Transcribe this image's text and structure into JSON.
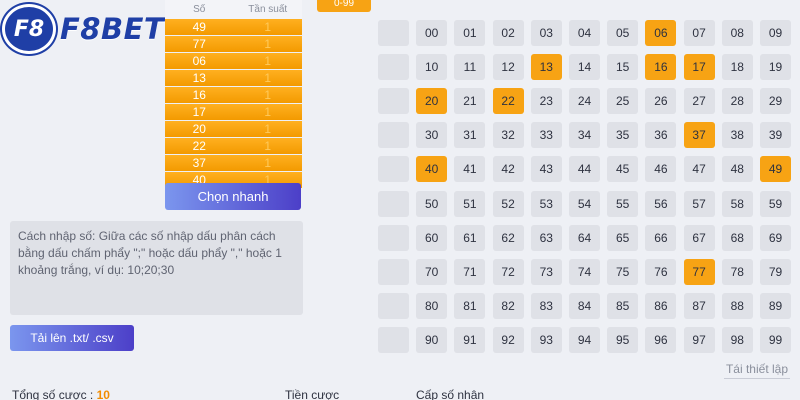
{
  "brand": {
    "badge": "F8",
    "name": "F8BET",
    "color": "#1f3fa6"
  },
  "numbers_panel": {
    "col_number": "Số",
    "col_freq": "Tần suất",
    "rows": [
      {
        "number": "49",
        "freq": "1"
      },
      {
        "number": "77",
        "freq": "1"
      },
      {
        "number": "06",
        "freq": "1"
      },
      {
        "number": "13",
        "freq": "1"
      },
      {
        "number": "16",
        "freq": "1"
      },
      {
        "number": "17",
        "freq": "1"
      },
      {
        "number": "20",
        "freq": "1"
      },
      {
        "number": "22",
        "freq": "1"
      },
      {
        "number": "37",
        "freq": "1"
      },
      {
        "number": "40",
        "freq": "1"
      }
    ]
  },
  "quick_pick_label": "Chọn nhanh",
  "top_range_label": "0-99",
  "hint_text": "Cách nhập số: Giữa các số nhập dấu phân cách bằng dấu chấm phẩy \";\" hoặc dấu phẩy \",\" hoặc 1 khoảng trắng, ví dụ: 10;20;30",
  "upload_label": "Tải lên .txt/ .csv",
  "grid": {
    "selected": [
      "06",
      "13",
      "16",
      "17",
      "20",
      "22",
      "37",
      "40",
      "49",
      "77"
    ],
    "rows": [
      [
        "00",
        "01",
        "02",
        "03",
        "04",
        "05",
        "06",
        "07",
        "08",
        "09"
      ],
      [
        "10",
        "11",
        "12",
        "13",
        "14",
        "15",
        "16",
        "17",
        "18",
        "19"
      ],
      [
        "20",
        "21",
        "22",
        "23",
        "24",
        "25",
        "26",
        "27",
        "28",
        "29"
      ],
      [
        "30",
        "31",
        "32",
        "33",
        "34",
        "35",
        "36",
        "37",
        "38",
        "39"
      ],
      [
        "40",
        "41",
        "42",
        "43",
        "44",
        "45",
        "46",
        "47",
        "48",
        "49"
      ],
      [
        "50",
        "51",
        "52",
        "53",
        "54",
        "55",
        "56",
        "57",
        "58",
        "59"
      ],
      [
        "60",
        "61",
        "62",
        "63",
        "64",
        "65",
        "66",
        "67",
        "68",
        "69"
      ],
      [
        "70",
        "71",
        "72",
        "73",
        "74",
        "75",
        "76",
        "77",
        "78",
        "79"
      ],
      [
        "80",
        "81",
        "82",
        "83",
        "84",
        "85",
        "86",
        "87",
        "88",
        "89"
      ],
      [
        "90",
        "91",
        "92",
        "93",
        "94",
        "95",
        "96",
        "97",
        "98",
        "99"
      ]
    ],
    "accent": "#f7a314"
  },
  "reset_label": "Tái thiết lập",
  "footer": {
    "total_bets_label": "Tổng số cược : ",
    "total_bets_value": "10",
    "stake_label": "Tiền cược",
    "multiplier_label": "Cấp số nhân"
  }
}
